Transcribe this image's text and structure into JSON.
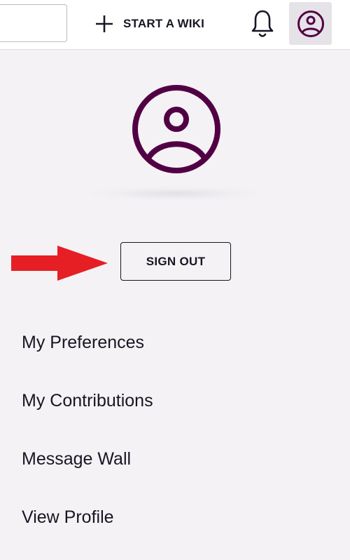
{
  "header": {
    "search_value": "",
    "start_wiki_label": "START A WIKI",
    "icons": {
      "plus": "plus-icon",
      "bell": "notification-bell-icon",
      "user": "user-account-icon"
    }
  },
  "account_panel": {
    "avatar_icon": "user-avatar-icon",
    "sign_out_label": "SIGN OUT",
    "annotation_arrow_color": "#e51f24",
    "brand_color": "#520044",
    "menu": [
      {
        "label": "My Preferences"
      },
      {
        "label": "My Contributions"
      },
      {
        "label": "Message Wall"
      },
      {
        "label": "View Profile"
      }
    ]
  }
}
